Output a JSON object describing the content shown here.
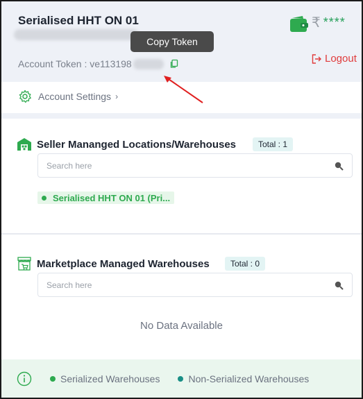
{
  "account": {
    "name": "Serialised HHT ON 01",
    "token_label": "Account Token : ve113198",
    "copy_tooltip": "Copy Token",
    "balance_currency": "₹",
    "balance_masked": "****",
    "logout_label": "Logout"
  },
  "settings": {
    "label": "Account Settings",
    "chevron": "›"
  },
  "seller_section": {
    "title": "Seller Mananged Locations/Warehouses",
    "total": "Total : 1",
    "search_placeholder": "Search here",
    "locations": [
      "Serialised HHT ON 01 (Pri..."
    ]
  },
  "marketplace_section": {
    "title": "Marketplace Managed Warehouses",
    "total": "Total : 0",
    "search_placeholder": "Search here",
    "empty_text": "No Data Available"
  },
  "legend": {
    "serialized": "Serialized Warehouses",
    "non_serialized": "Non-Serialized Warehouses",
    "serialized_color": "#2eaa4f",
    "non_serialized_color": "#1a8f86"
  },
  "icons": [
    "wallet-icon",
    "copy-icon",
    "logout-icon",
    "gear-icon",
    "warehouse-icon",
    "store-icon",
    "search-icon",
    "info-icon"
  ],
  "colors": {
    "accent_green": "#2eaa4f",
    "logout_red": "#e03b3b",
    "header_bg": "#eef1f7",
    "footer_bg": "#eaf6ee"
  }
}
